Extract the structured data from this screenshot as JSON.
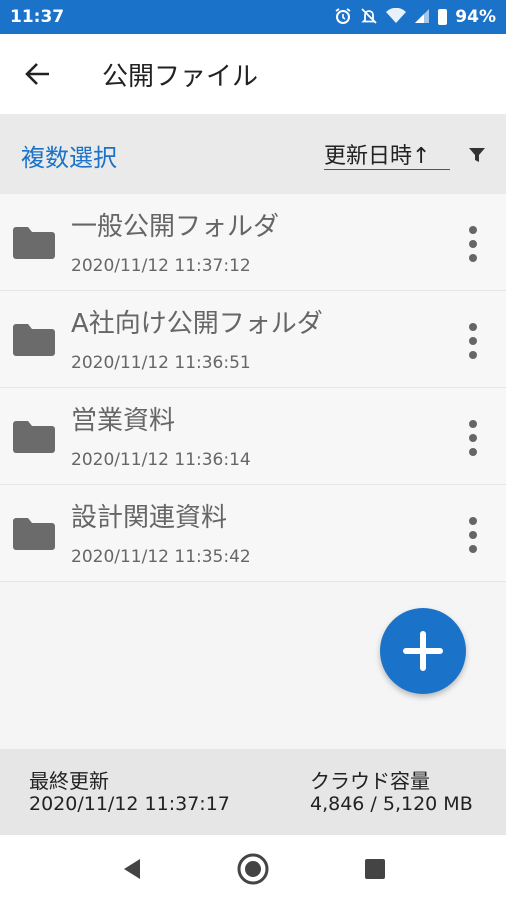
{
  "status_bar": {
    "time": "11:37",
    "battery": "94%",
    "icons": [
      "alarm-icon",
      "mute-icon",
      "wifi-icon",
      "signal-icon",
      "battery-icon"
    ]
  },
  "app_bar": {
    "title": "公開ファイル",
    "back_icon": "back-arrow-icon"
  },
  "toolbar": {
    "multi_select_label": "複数選択",
    "sort_label": "更新日時↑",
    "filter_icon": "filter-icon"
  },
  "folders": [
    {
      "name": "一般公開フォルダ",
      "date": "2020/11/12 11:37:12"
    },
    {
      "name": "A社向け公開フォルダ",
      "date": "2020/11/12 11:36:51"
    },
    {
      "name": "営業資料",
      "date": "2020/11/12 11:36:14"
    },
    {
      "name": "設計関連資料",
      "date": "2020/11/12 11:35:42"
    }
  ],
  "fab": {
    "icon": "add-icon"
  },
  "footer": {
    "last_updated_label": "最終更新",
    "last_updated_value": "2020/11/12 11:37:17",
    "capacity_label": "クラウド容量",
    "capacity_value": "4,846 / 5,120 MB"
  },
  "colors": {
    "accent": "#1a73c9",
    "toolbar_bg": "#eaeaea",
    "footer_bg": "#e6e6e6"
  }
}
